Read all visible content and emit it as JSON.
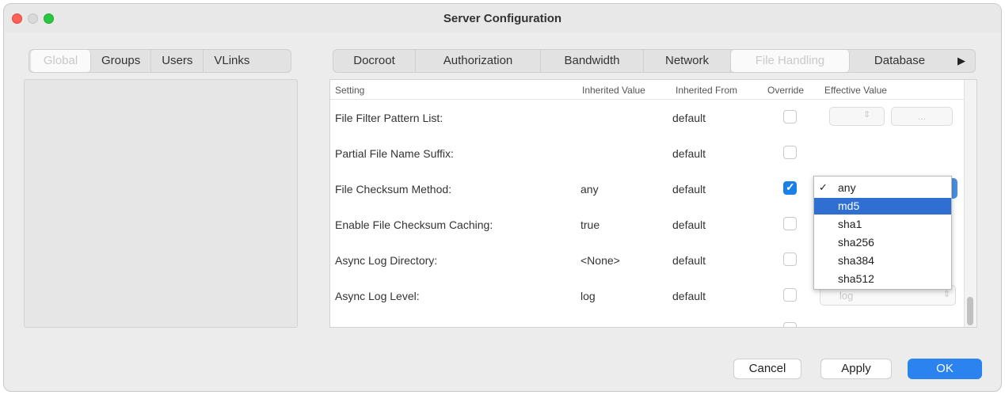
{
  "window": {
    "title": "Server Configuration"
  },
  "left_tabs": [
    "Global",
    "Groups",
    "Users",
    "VLinks"
  ],
  "right_tabs": [
    "Docroot",
    "Authorization",
    "Bandwidth",
    "Network",
    "File Handling",
    "Database"
  ],
  "table": {
    "headers": [
      "Setting",
      "Inherited Value",
      "Inherited From",
      "Override",
      "Effective Value"
    ],
    "rows": [
      {
        "setting": "File Filter Pattern List:",
        "inherited_value": "",
        "inherited_from": "default",
        "override": false
      },
      {
        "setting": "Partial File Name Suffix:",
        "inherited_value": "",
        "inherited_from": "default",
        "override": false
      },
      {
        "setting": "File Checksum Method:",
        "inherited_value": "any",
        "inherited_from": "default",
        "override": true
      },
      {
        "setting": "Enable File Checksum Caching:",
        "inherited_value": "true",
        "inherited_from": "default",
        "override": false
      },
      {
        "setting": "Async Log Directory:",
        "inherited_value": "<None>",
        "inherited_from": "default",
        "override": false
      },
      {
        "setting": "Async Log Level:",
        "inherited_value": "log",
        "inherited_from": "default",
        "override": false,
        "effective_value": "log"
      }
    ],
    "browse_label": "..."
  },
  "checksum_menu": {
    "options": [
      "any",
      "md5",
      "sha1",
      "sha256",
      "sha384",
      "sha512"
    ],
    "checked": "any",
    "highlighted": "md5",
    "check_glyph": "✓"
  },
  "buttons": {
    "cancel": "Cancel",
    "apply": "Apply",
    "ok": "OK"
  }
}
